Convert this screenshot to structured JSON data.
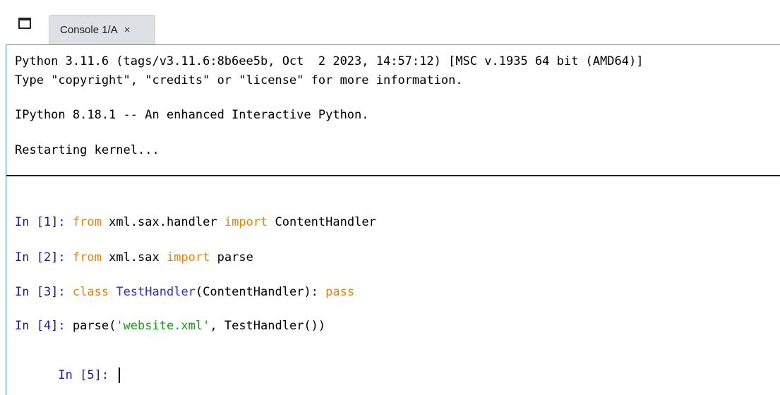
{
  "tabbar": {
    "tab_label": "Console 1/A",
    "tab_close": "×"
  },
  "console": {
    "banner": [
      "Python 3.11.6 (tags/v3.11.6:8b6ee5b, Oct  2 2023, 14:57:12) [MSC v.1935 64 bit (AMD64)]",
      "Type \"copyright\", \"credits\" or \"license\" for more information.",
      "IPython 8.18.1 -- An enhanced Interactive Python.",
      "Restarting kernel..."
    ],
    "cells": [
      {
        "prompt": "In [1]: ",
        "tokens": [
          {
            "t": "from",
            "k": "kw"
          },
          {
            "t": " xml.sax.handler ",
            "k": "plain"
          },
          {
            "t": "import",
            "k": "kw"
          },
          {
            "t": " ContentHandler",
            "k": "plain"
          }
        ]
      },
      {
        "prompt": "In [2]: ",
        "tokens": [
          {
            "t": "from",
            "k": "kw"
          },
          {
            "t": " xml.sax ",
            "k": "plain"
          },
          {
            "t": "import",
            "k": "kw"
          },
          {
            "t": " parse",
            "k": "plain"
          }
        ]
      },
      {
        "prompt": "In [3]: ",
        "tokens": [
          {
            "t": "class",
            "k": "kw"
          },
          {
            "t": " ",
            "k": "plain"
          },
          {
            "t": "TestHandler",
            "k": "cls"
          },
          {
            "t": "(ContentHandler): ",
            "k": "plain"
          },
          {
            "t": "pass",
            "k": "kw"
          }
        ]
      },
      {
        "prompt": "In [4]: ",
        "tokens": [
          {
            "t": "parse(",
            "k": "plain"
          },
          {
            "t": "'website.xml'",
            "k": "str"
          },
          {
            "t": ", TestHandler())",
            "k": "plain"
          }
        ]
      }
    ],
    "active_prompt": "In [5]: "
  },
  "colors": {
    "prompt": "#1a1a9e",
    "keyword": "#f08000",
    "class_name": "#2f2fd0",
    "string": "#1f9a1f",
    "focus_border": "#4a90c8"
  },
  "icons": {
    "window_toggle": "window-icon",
    "tab_close": "close-icon"
  }
}
